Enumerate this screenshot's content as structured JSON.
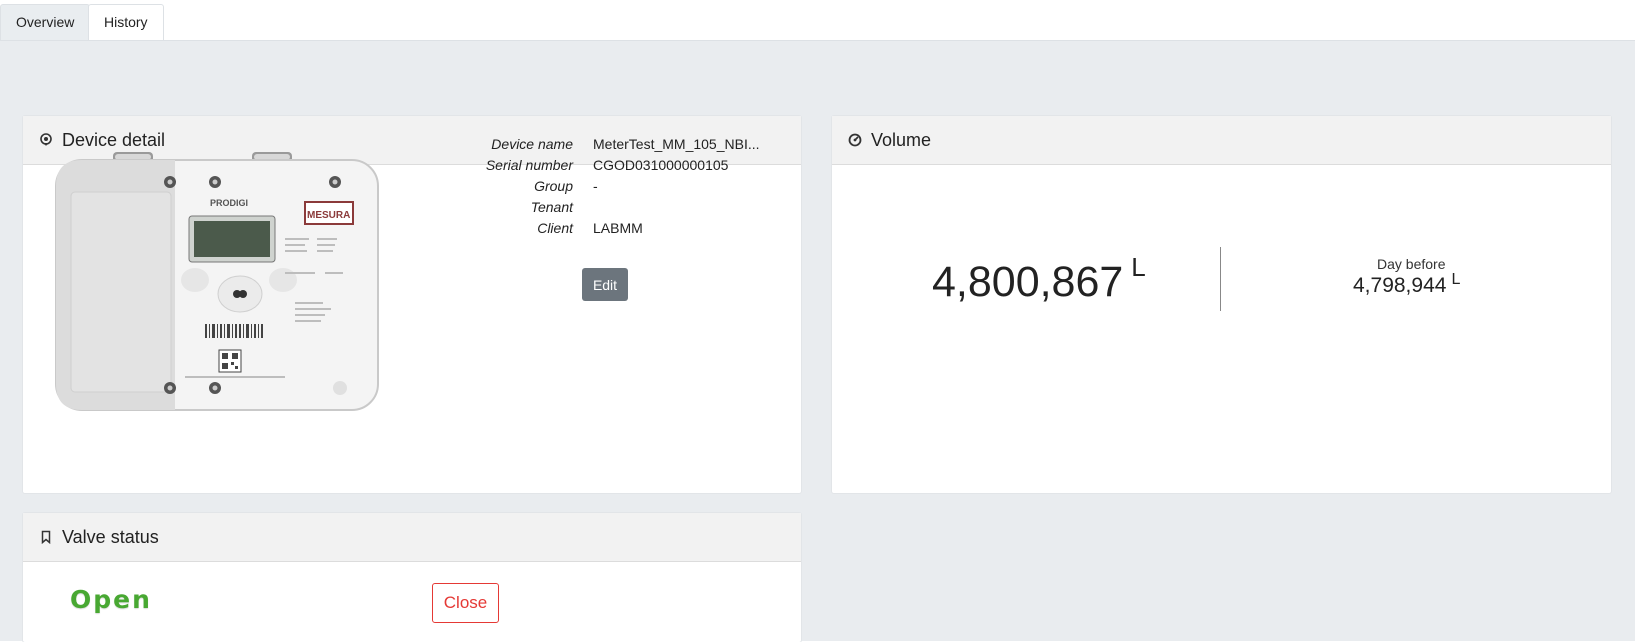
{
  "tabs": [
    {
      "label": "Overview",
      "active": true
    },
    {
      "label": "History",
      "active": false
    }
  ],
  "device_detail": {
    "title": "Device detail",
    "icon": "location-pin-icon",
    "image_brand_text": "PRODIGI",
    "image_logo_text": "MESURA",
    "fields": [
      {
        "label": "Device name",
        "value": "MeterTest_MM_105_NBI..."
      },
      {
        "label": "Serial number",
        "value": "CGOD031000000105"
      },
      {
        "label": "Group",
        "value": "-"
      },
      {
        "label": "Tenant",
        "value": ""
      },
      {
        "label": "Client",
        "value": "LABMM"
      }
    ],
    "edit_label": "Edit"
  },
  "volume": {
    "title": "Volume",
    "icon": "gauge-icon",
    "current_value": "4,800,867",
    "unit": "L",
    "previous_label": "Day before",
    "previous_value": "4,798,944",
    "previous_unit": "L"
  },
  "valve": {
    "title": "Valve status",
    "icon": "bookmark-icon",
    "status": "Open",
    "status_color": "#48a832",
    "close_label": "Close",
    "close_color": "#e53935"
  }
}
